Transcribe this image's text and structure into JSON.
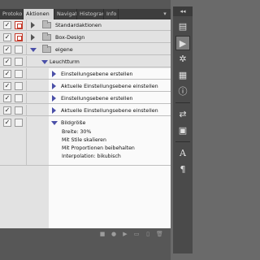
{
  "tabs": [
    "Protokoll",
    "Aktionen",
    "Navigator",
    "Histogramm",
    "Info"
  ],
  "tab_menu": "▾",
  "rows": [
    {
      "label": "Standardaktionen",
      "checked": "✓",
      "dialog": "red"
    },
    {
      "label": "Box-Design",
      "checked": "✓",
      "dialog": "red"
    },
    {
      "label": "eigene",
      "checked": "✓",
      "dialog": ""
    },
    {
      "label": "Leuchtturm",
      "checked": "✓",
      "dialog": ""
    },
    {
      "label": "Einstellungsebene erstellen",
      "checked": "✓",
      "dialog": ""
    },
    {
      "label": "Aktuelle Einstellungsebene einstellen",
      "checked": "✓",
      "dialog": ""
    },
    {
      "label": "Einstellungsebene erstellen",
      "checked": "✓",
      "dialog": ""
    },
    {
      "label": "Aktuelle Einstellungsebene einstellen",
      "checked": "✓",
      "dialog": ""
    },
    {
      "label": "Bildgröße",
      "checked": "✓",
      "dialog": ""
    }
  ],
  "details": [
    "Breite: 30%",
    "Mit Stile skalieren",
    "Mit Proportionen beibehalten",
    "Interpolation: bikubisch"
  ],
  "bottom_icons": [
    "stop-icon",
    "record-icon",
    "play-icon",
    "new-set-icon",
    "new-action-icon",
    "delete-icon"
  ],
  "bottom_glyphs": [
    "■",
    "●",
    "▶",
    "▭",
    "▯",
    "🗑"
  ],
  "dock": {
    "top_glyph": "◂◂",
    "glyphs": [
      "▤",
      "▶",
      "✲",
      "▦",
      "ⓘ",
      "⇄",
      "▣",
      "A",
      "¶"
    ]
  }
}
